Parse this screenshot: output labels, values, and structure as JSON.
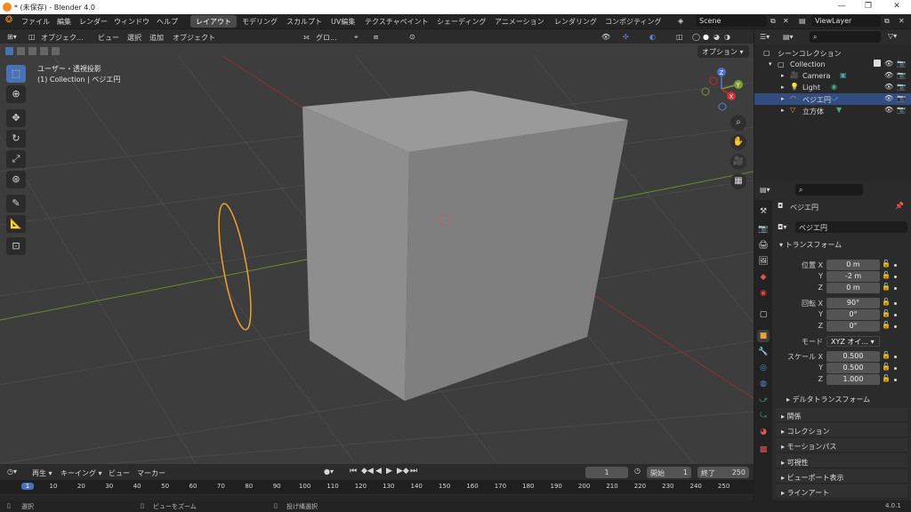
{
  "window": {
    "title": "* (未保存) - Blender 4.0"
  },
  "menu": {
    "items": [
      "ファイル",
      "編集",
      "レンダー",
      "ウィンドウ",
      "ヘルプ"
    ]
  },
  "workspaces": [
    "レイアウト",
    "モデリング",
    "スカルプト",
    "UV編集",
    "テクスチャペイント",
    "シェーディング",
    "アニメーション",
    "レンダリング",
    "コンポジティング"
  ],
  "scene": {
    "name": "Scene",
    "view_layer": "ViewLayer"
  },
  "viewport": {
    "mode": "オブジェク...",
    "menus": [
      "ビュー",
      "選択",
      "追加",
      "オブジェクト"
    ],
    "transform": "グロ...",
    "options": "オプション",
    "view_name": "ユーザー・透視投影",
    "context": "(1) Collection | ベジエ円"
  },
  "outliner": {
    "root": "シーンコレクション",
    "collection": "Collection",
    "items": [
      {
        "name": "Camera",
        "color": "#e8a040"
      },
      {
        "name": "Light",
        "color": "#e8a040"
      },
      {
        "name": "ベジエ円",
        "color": "#e8a040"
      },
      {
        "name": "立方体",
        "color": "#e8a040"
      }
    ]
  },
  "properties": {
    "object_name": "ベジエ円",
    "name_field": "ベジエ円",
    "transform_title": "トランスフォーム",
    "loc_label": "位置 X",
    "loc": [
      "0 m",
      "-2 m",
      "0 m"
    ],
    "rot_label": "回転 X",
    "rot": [
      "90°",
      "0°",
      "0°"
    ],
    "mode_label": "モード",
    "mode": "XYZ オイ...",
    "scale_label": "スケール X",
    "scale": [
      "0.500",
      "0.500",
      "1.000"
    ],
    "axis_y": "Y",
    "axis_z": "Z",
    "delta": "デルタトランスフォーム",
    "panels": [
      "関係",
      "コレクション",
      "モーションパス",
      "可視性",
      "ビューポート表示",
      "ラインアート"
    ]
  },
  "timeline": {
    "play": "再生",
    "keying": "キーイング",
    "view": "ビュー",
    "marker": "マーカー",
    "current": "1",
    "start_label": "開始",
    "start": "1",
    "end_label": "終了",
    "end": "250",
    "ticks": [
      "1",
      "10",
      "20",
      "30",
      "40",
      "50",
      "60",
      "70",
      "80",
      "90",
      "100",
      "110",
      "120",
      "130",
      "140",
      "150",
      "160",
      "170",
      "180",
      "190",
      "200",
      "210",
      "220",
      "230",
      "240",
      "250"
    ]
  },
  "status": {
    "select": "選択",
    "zoom": "ビューをズーム",
    "lasso": "投げ縄選択",
    "version": "4.0.1"
  }
}
